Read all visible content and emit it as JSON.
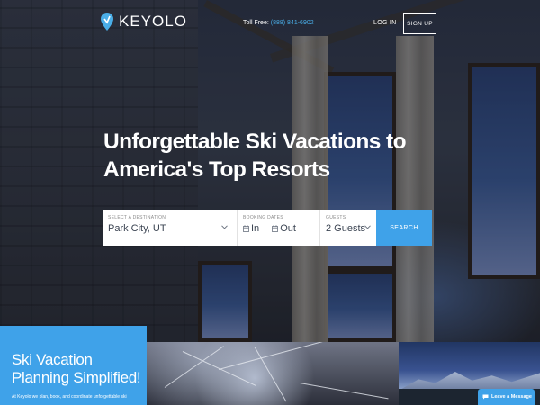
{
  "header": {
    "logo_text": "KEYOLO",
    "toll_free_label": "Toll Free:",
    "toll_free_number": "(888) 841-6902",
    "login_label": "LOG IN",
    "signup_label": "SIGN UP"
  },
  "hero": {
    "headline": "Unforgettable Ski Vacations to America's Top Resorts"
  },
  "search": {
    "destination_label": "SELECT A DESTINATION",
    "destination_value": "Park City, UT",
    "dates_label": "BOOKING DATES",
    "checkin_label": "In",
    "checkout_label": "Out",
    "guests_label": "GUESTS",
    "guests_value": "2 Guests",
    "search_button": "SEARCH"
  },
  "promo": {
    "title": "Ski Vacation Planning Simplified!",
    "subtitle": "At Keyolo we plan, book, and coordinate unforgettable ski"
  },
  "chat": {
    "label": "Leave a Message"
  },
  "colors": {
    "accent": "#3fa2e9",
    "text_dark": "#3b4452"
  }
}
